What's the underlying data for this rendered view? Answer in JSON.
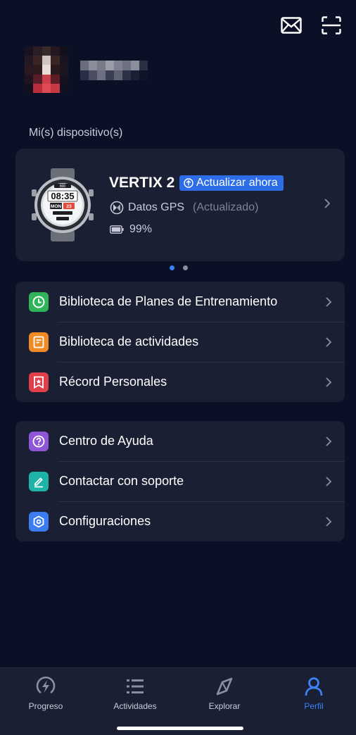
{
  "header": {
    "mail_icon": "mail-icon",
    "scan_icon": "scan-icon"
  },
  "profile": {
    "avatar": "pixelated-avatar",
    "name": "pixelated-username"
  },
  "devices": {
    "section_label": "Mi(s) dispositivo(s)",
    "card": {
      "name": "VERTIX 2",
      "update_label": "Actualizar ahora",
      "gps_label": "Datos GPS",
      "gps_status": "(Actualizado)",
      "battery": "99%",
      "watch_time": "08:35",
      "watch_day": "MON",
      "watch_date": "23"
    },
    "pager": {
      "total": 2,
      "active": 0
    }
  },
  "menu_group_1": [
    {
      "label": "Biblioteca de Planes de Entrenamiento",
      "icon": "clock-icon",
      "color": "#2fb45a"
    },
    {
      "label": "Biblioteca de actividades",
      "icon": "document-icon",
      "color": "#f08a24"
    },
    {
      "label": "Récord Personales",
      "icon": "bookmark-star-icon",
      "color": "#e0404a"
    }
  ],
  "menu_group_2": [
    {
      "label": "Centro de Ayuda",
      "icon": "question-icon",
      "color": "#8e55d6"
    },
    {
      "label": "Contactar con soporte",
      "icon": "pencil-icon",
      "color": "#1fb2a6"
    },
    {
      "label": "Configuraciones",
      "icon": "hexagon-settings-icon",
      "color": "#3b7cf0"
    }
  ],
  "bottom_nav": [
    {
      "label": "Progreso",
      "icon": "lightning-circle-icon",
      "active": false
    },
    {
      "label": "Actividades",
      "icon": "list-icon",
      "active": false
    },
    {
      "label": "Explorar",
      "icon": "compass-icon",
      "active": false
    },
    {
      "label": "Perfil",
      "icon": "person-icon",
      "active": true
    }
  ],
  "colors": {
    "background": "#0b1027",
    "card": "#1a1f33",
    "accent": "#3b82f6",
    "badge": "#2d6ee8"
  }
}
